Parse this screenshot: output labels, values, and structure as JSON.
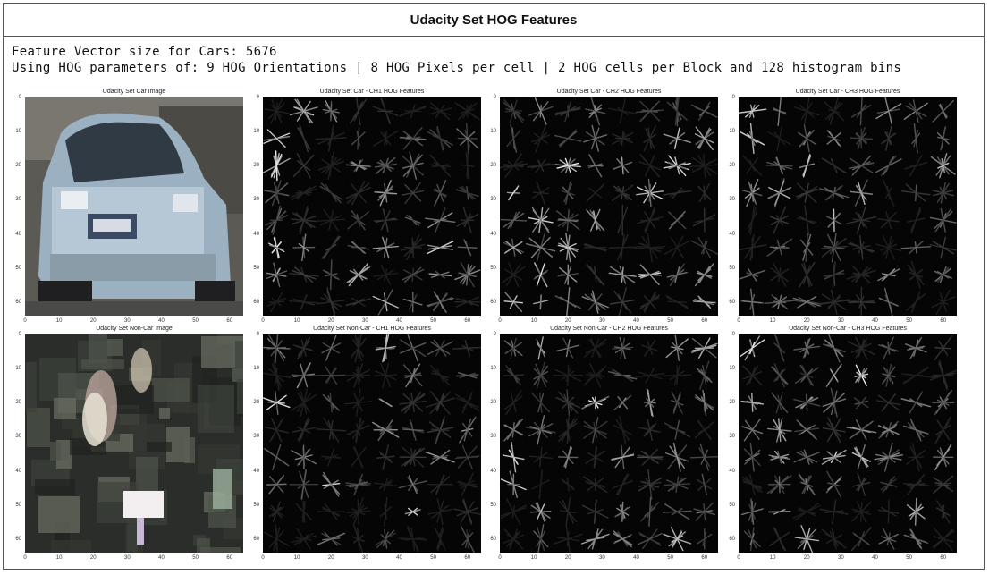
{
  "title": "Udacity Set HOG Features",
  "info": {
    "line1": "Feature Vector size for Cars: 5676",
    "line2": "Using HOG parameters of: 9 HOG Orientations | 8 HOG Pixels per cell | 2 HOG cells per Block and 128 histogram bins"
  },
  "axis": {
    "yticks": [
      "0",
      "10",
      "20",
      "30",
      "40",
      "50",
      "60"
    ],
    "xticks": [
      "0",
      "10",
      "20",
      "30",
      "40",
      "50",
      "60"
    ]
  },
  "panels": [
    {
      "title": "Udacity Set Car Image",
      "kind": "car"
    },
    {
      "title": "Udacity Set Car - CH1 HOG Features",
      "kind": "hog"
    },
    {
      "title": "Udacity Set Car - CH2 HOG Features",
      "kind": "hog"
    },
    {
      "title": "Udacity Set Car - CH3 HOG Features",
      "kind": "hog"
    },
    {
      "title": "Udacity Set Non-Car Image",
      "kind": "noncar"
    },
    {
      "title": "Udacity Set Non-Car - CH1 HOG Features",
      "kind": "hog"
    },
    {
      "title": "Udacity Set Non-Car - CH2 HOG Features",
      "kind": "hog"
    },
    {
      "title": "Udacity Set Non-Car - CH3 HOG Features",
      "kind": "hog"
    }
  ]
}
